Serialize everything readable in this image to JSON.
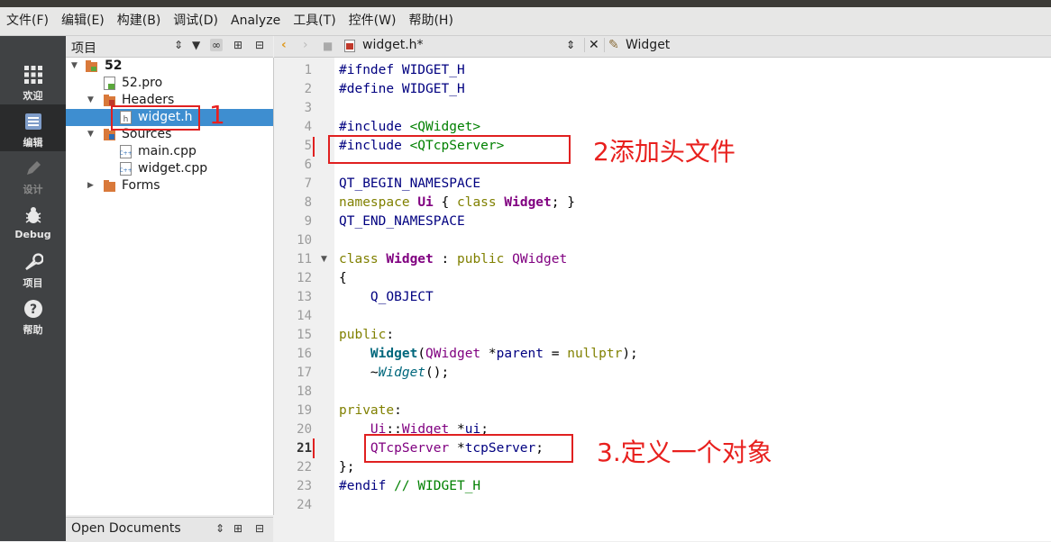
{
  "menubar": [
    "文件(F)",
    "编辑(E)",
    "构建(B)",
    "调试(D)",
    "Analyze",
    "工具(T)",
    "控件(W)",
    "帮助(H)"
  ],
  "modes": [
    {
      "label": "欢迎",
      "icon": "welcome-grid-icon"
    },
    {
      "label": "编辑",
      "icon": "edit-document-icon"
    },
    {
      "label": "设计",
      "icon": "design-pen-icon"
    },
    {
      "label": "Debug",
      "icon": "debug-bug-icon"
    },
    {
      "label": "项目",
      "icon": "project-wrench-icon"
    },
    {
      "label": "帮助",
      "icon": "help-question-icon"
    }
  ],
  "project_panel": {
    "title": "项目",
    "tree": [
      {
        "label": "52",
        "kind": "project"
      },
      {
        "label": "52.pro",
        "kind": "pro-file"
      },
      {
        "label": "Headers",
        "kind": "folder"
      },
      {
        "label": "widget.h",
        "kind": "header-file",
        "selected": true
      },
      {
        "label": "Sources",
        "kind": "folder"
      },
      {
        "label": "main.cpp",
        "kind": "cpp-file"
      },
      {
        "label": "widget.cpp",
        "kind": "cpp-file"
      },
      {
        "label": "Forms",
        "kind": "folder"
      }
    ],
    "open_documents_title": "Open Documents"
  },
  "editor": {
    "file_tab": "widget.h*",
    "symbol": "Widget",
    "line_numbers": [
      "1",
      "2",
      "3",
      "4",
      "5",
      "6",
      "7",
      "8",
      "9",
      "10",
      "11",
      "12",
      "13",
      "14",
      "15",
      "16",
      "17",
      "18",
      "19",
      "20",
      "21",
      "22",
      "23",
      "24"
    ],
    "current_line": "21"
  },
  "annotations": {
    "a1": "1",
    "a2": "2添加头文件",
    "a3": "3.定义一个对象"
  },
  "colors": {
    "annotation": "#e02020",
    "selection": "#3e8ed0",
    "modebar": "#404244"
  }
}
